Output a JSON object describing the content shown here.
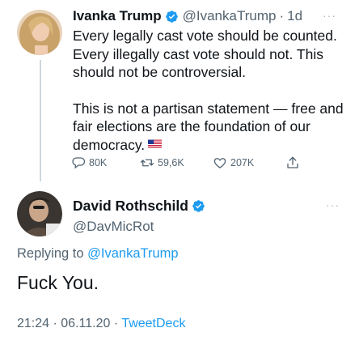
{
  "original_tweet": {
    "author_name": "Ivanka Trump",
    "handle": "@IvankaTrump",
    "separator": "·",
    "time_ago": "1d",
    "more_label": "···",
    "paragraph1": "Every legally cast vote should be counted. Every illegally cast vote should not. This should not be controversial.",
    "paragraph2": "This is not a partisan statement — free and fair elections are the foundation of our democracy.",
    "flag_icon": "us-flag-icon",
    "actions": {
      "replies": "80K",
      "retweets": "59,6K",
      "likes": "207K"
    }
  },
  "reply_tweet": {
    "author_name": "David Rothschild",
    "handle": "@DavMicRot",
    "more_label": "···",
    "replying_prefix": "Replying to",
    "replying_to": "@IvankaTrump",
    "text": "Fuck You.",
    "time": "21:24",
    "date": "06.11.20",
    "dot": "·",
    "source": "TweetDeck"
  },
  "colors": {
    "accent": "#1d9bf0",
    "muted": "#536471",
    "text": "#0f1419",
    "thread_line": "#cfd9de"
  }
}
